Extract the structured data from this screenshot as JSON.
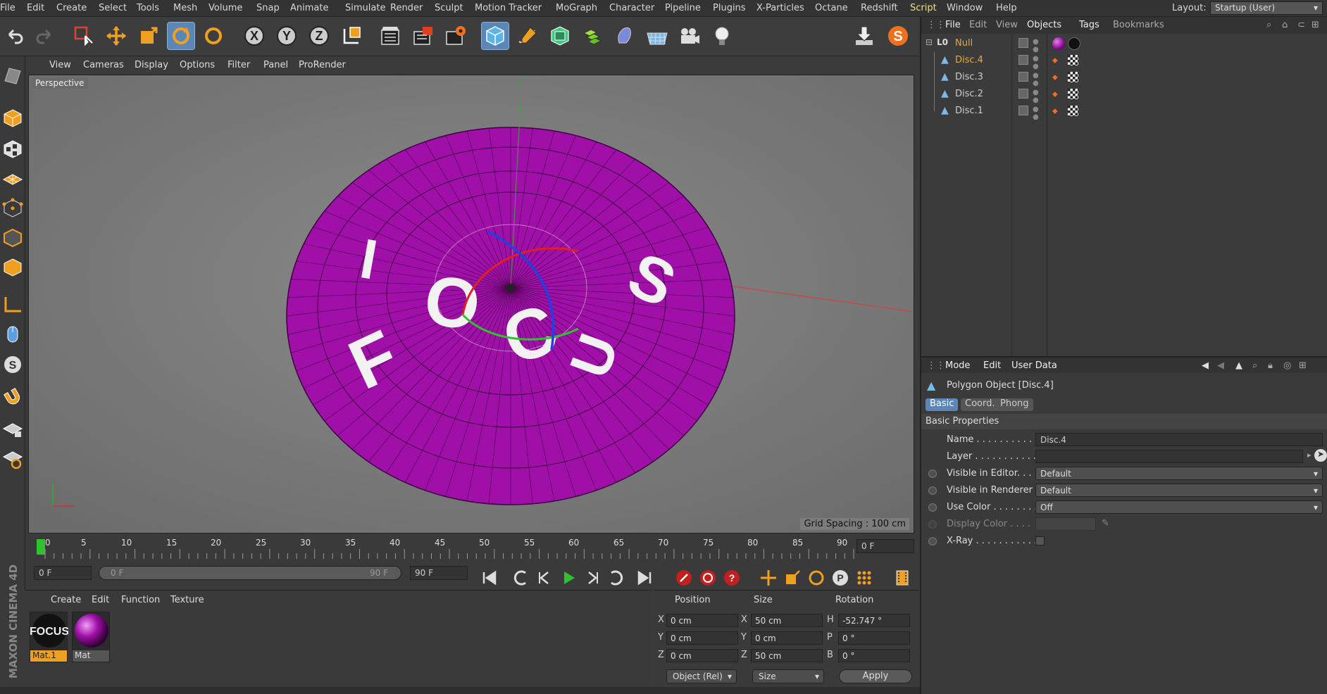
{
  "menubar": {
    "items": [
      "File",
      "Edit",
      "Create",
      "Select",
      "Tools",
      "Mesh",
      "Volume",
      "Snap",
      "Animate",
      "Simulate",
      "Render",
      "Sculpt",
      "Motion Tracker",
      "MoGraph",
      "Character",
      "Pipeline",
      "Plugins",
      "X-Particles",
      "Octane",
      "Redshift",
      "Script",
      "Window",
      "Help"
    ],
    "layout_label": "Layout:",
    "layout_value": "Startup (User)"
  },
  "toolbar": {
    "icons": [
      "undo-icon",
      "redo-icon",
      "live-selection-icon",
      "move-icon",
      "scale-icon",
      "rotate-icon",
      "recent-tool-icon",
      "x-axis-lock-icon",
      "y-axis-lock-icon",
      "z-axis-lock-icon",
      "coordinate-system-icon",
      "render-view-icon",
      "render-picture-viewer-icon",
      "render-settings-icon",
      "cube-primitive-icon",
      "pen-spline-icon",
      "subdivision-icon",
      "cloner-icon",
      "deformer-icon",
      "floor-icon",
      "camera-icon",
      "light-icon",
      "install-icon",
      "script-s-icon"
    ],
    "axis_labels": [
      "X",
      "Y",
      "Z"
    ],
    "script_glyph": "S"
  },
  "viewport": {
    "menu": [
      "View",
      "Cameras",
      "Display",
      "Options",
      "Filter",
      "Panel",
      "ProRender"
    ],
    "label": "Perspective",
    "grid_spacing": "Grid Spacing : 100 cm",
    "disc_color": "#a010a8",
    "text_on_disc": "FOCUS"
  },
  "timeline": {
    "ticks": [
      "0",
      "5",
      "10",
      "15",
      "20",
      "25",
      "30",
      "35",
      "40",
      "45",
      "50",
      "55",
      "60",
      "65",
      "70",
      "75",
      "80",
      "85",
      "90"
    ],
    "current_frame": "0 F"
  },
  "playbar": {
    "start_field": "0 F",
    "range_start": "0 F",
    "range_end": "90 F",
    "end_field": "90 F"
  },
  "materials": {
    "menu": [
      "Create",
      "Edit",
      "Function",
      "Texture"
    ],
    "items": [
      {
        "label": "Mat.1",
        "selected": true
      },
      {
        "label": "Mat",
        "selected": false
      }
    ],
    "focus_thumb_text": "FOCUS"
  },
  "coords": {
    "headers": [
      "Position",
      "Size",
      "Rotation"
    ],
    "rows": [
      {
        "axis": "X",
        "position": "0 cm",
        "size_axis": "X",
        "size": "50 cm",
        "rot_axis": "H",
        "rotation": "-52.747 °"
      },
      {
        "axis": "Y",
        "position": "0 cm",
        "size_axis": "Y",
        "size": "0 cm",
        "rot_axis": "P",
        "rotation": "0 °"
      },
      {
        "axis": "Z",
        "position": "0 cm",
        "size_axis": "Z",
        "size": "50 cm",
        "rot_axis": "B",
        "rotation": "0 °"
      }
    ],
    "mode_select": "Object (Rel)",
    "size_select": "Size",
    "apply_label": "Apply"
  },
  "maxon_text": "MAXON CINEMA 4D",
  "object_manager": {
    "menu": [
      "File",
      "Edit",
      "View",
      "Objects",
      "Tags",
      "Bookmarks"
    ],
    "objects": [
      {
        "name": "Null",
        "level": 0,
        "highlight": true
      },
      {
        "name": "Disc.4",
        "level": 1,
        "highlight": true
      },
      {
        "name": "Disc.3",
        "level": 1,
        "highlight": false
      },
      {
        "name": "Disc.2",
        "level": 1,
        "highlight": false
      },
      {
        "name": "Disc.1",
        "level": 1,
        "highlight": false
      }
    ],
    "null_icon": "L0"
  },
  "attributes": {
    "menu": [
      "Mode",
      "Edit",
      "User Data"
    ],
    "title": "Polygon Object [Disc.4]",
    "tabs": [
      "Basic",
      "Coord.",
      "Phong"
    ],
    "section": "Basic Properties",
    "props": [
      {
        "label": "Name . . . . . . . . . . . .",
        "value": "Disc.4",
        "type": "text"
      },
      {
        "label": "Layer . . . . . . . . . . . .",
        "value": "",
        "type": "text"
      },
      {
        "label": "Visible in Editor. . .",
        "value": "Default",
        "type": "select"
      },
      {
        "label": "Visible in Renderer",
        "value": "Default",
        "type": "select"
      },
      {
        "label": "Use Color . . . . . . . .",
        "value": "Off",
        "type": "select"
      },
      {
        "label": "Display Color . . . .",
        "value": "",
        "type": "color"
      },
      {
        "label": "X-Ray . . . . . . . . . . . .",
        "value": "",
        "type": "checkbox"
      }
    ]
  }
}
